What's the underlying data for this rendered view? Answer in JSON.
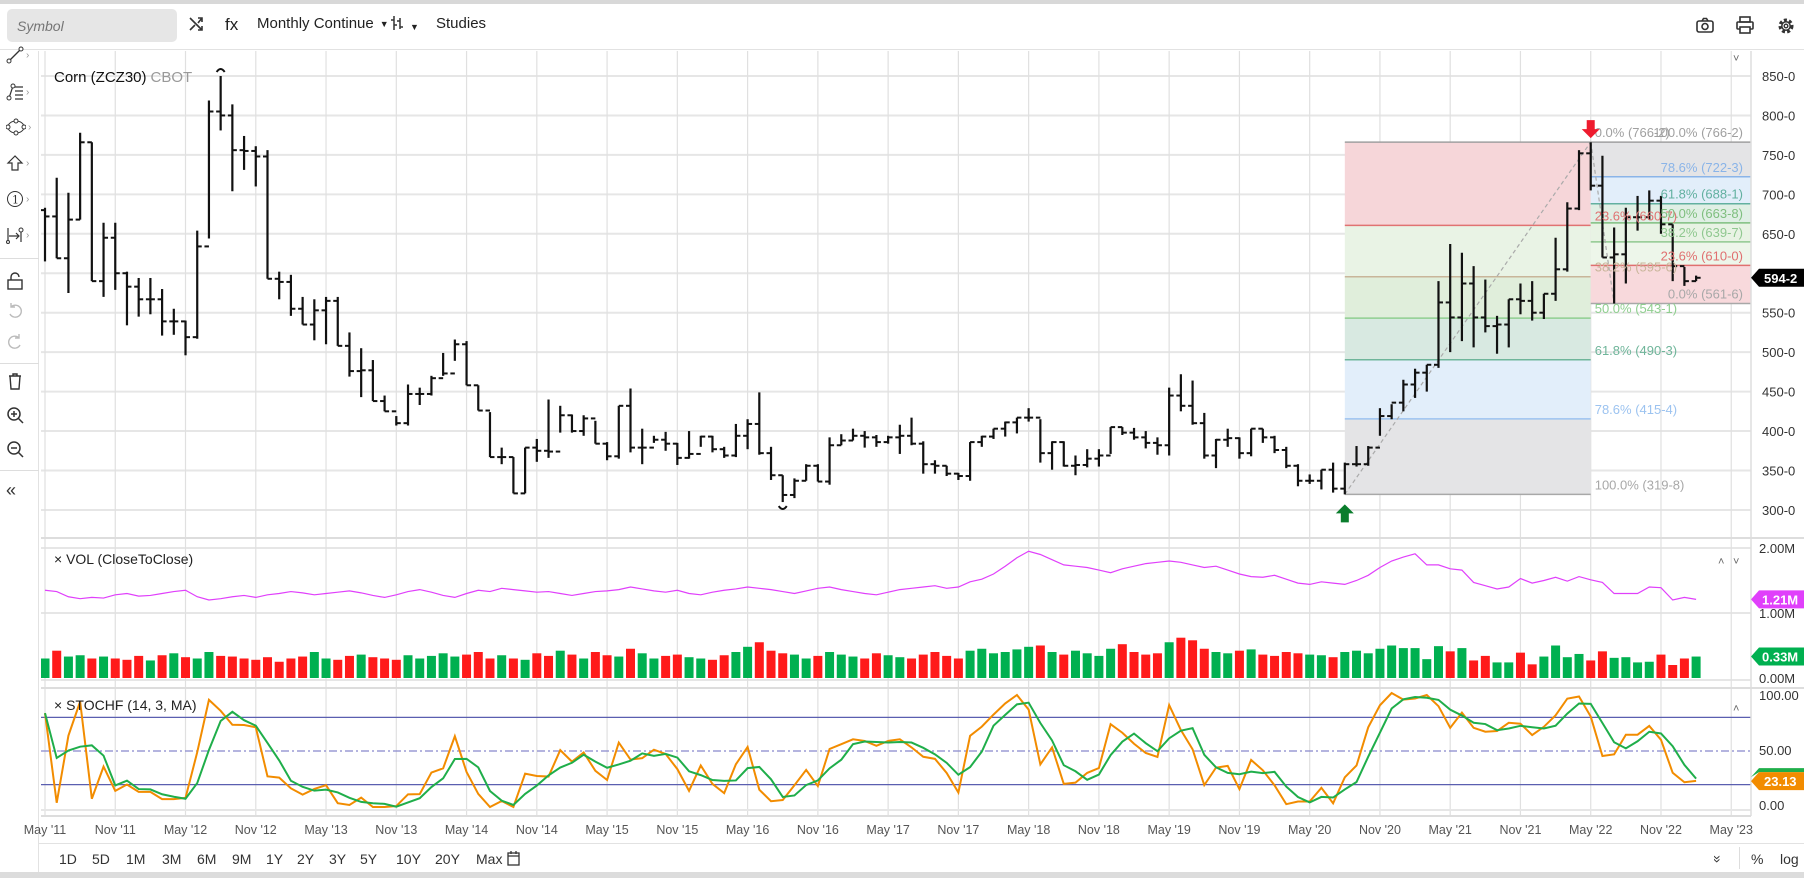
{
  "toolbar": {
    "symbol_placeholder": "Symbol",
    "fx_label": "fx",
    "interval": "Monthly Continue",
    "studies": "Studies"
  },
  "chart": {
    "title": "Corn (ZCZ30)",
    "exchange": "CBOT",
    "last_price": "594-2",
    "last_price_value": 594.25
  },
  "price_axis": [
    "850-0",
    "800-0",
    "750-0",
    "700-0",
    "650-0",
    "600-0",
    "550-0",
    "500-0",
    "450-0",
    "400-0",
    "350-0",
    "300-0"
  ],
  "date_labels": [
    "May '11",
    "Nov '11",
    "May '12",
    "Nov '12",
    "May '13",
    "Nov '13",
    "May '14",
    "Nov '14",
    "May '15",
    "Nov '15",
    "May '16",
    "Nov '16",
    "May '17",
    "Nov '17",
    "May '18",
    "Nov '18",
    "May '19",
    "Nov '19",
    "May '20",
    "Nov '20",
    "May '21",
    "Nov '21",
    "May '22",
    "Nov '22",
    "May '23"
  ],
  "vol_study": {
    "label": "× VOL (CloseToClose)",
    "axis": [
      "2.00M",
      "1.00M",
      "0.00M"
    ],
    "line_last": "1.21M",
    "volume_last": "0.33M",
    "line_color": "#e040fb",
    "up_color": "#00b050",
    "down_color": "#ff1a1a"
  },
  "stoch_study": {
    "label": "× STOCHF (14, 3, MA)",
    "axis": [
      "100.00",
      "50.00",
      "0.00"
    ],
    "last": "23.13",
    "k_color": "#f28c00",
    "d_color": "#1fae4a",
    "upper_band": 80,
    "lower_band": 20
  },
  "fib_left": [
    {
      "label": "0.0% (766-2)",
      "price": 766.25,
      "color": "#a0a0a0"
    },
    {
      "label": "23.6% (660-7)",
      "price": 660.7,
      "color": "#e07272"
    },
    {
      "label": "38.2% (595-6)",
      "price": 595.6,
      "color": "#c9b59a"
    },
    {
      "label": "50.0% (543-1)",
      "price": 543.1,
      "color": "#8fcf8f"
    },
    {
      "label": "61.8% (490-3)",
      "price": 490.3,
      "color": "#6fb59a"
    },
    {
      "label": "78.6% (415-4)",
      "price": 415.4,
      "color": "#9cc3f0"
    },
    {
      "label": "100.0% (319-8)",
      "price": 319.8,
      "color": "#a8a8a8"
    }
  ],
  "fib_right": [
    {
      "label": "100.0% (766-2)",
      "price": 766.25,
      "color": "#a0a0a0"
    },
    {
      "label": "78.6% (722-3)",
      "price": 722.3,
      "color": "#8ab4e8"
    },
    {
      "label": "61.8% (688-1)",
      "price": 688.1,
      "color": "#62b0a0"
    },
    {
      "label": "50.0% (663-8)",
      "price": 663.8,
      "color": "#7fbf7f"
    },
    {
      "label": "38.2% (639-7)",
      "price": 639.7,
      "color": "#90c890"
    },
    {
      "label": "23.6% (610-0)",
      "price": 610.0,
      "color": "#e07070"
    },
    {
      "label": "0.0% (561-6)",
      "price": 561.6,
      "color": "#a8a8a8"
    }
  ],
  "ranges": [
    "1D",
    "5D",
    "1M",
    "3M",
    "6M",
    "9M",
    "1Y",
    "2Y",
    "3Y",
    "5Y",
    "10Y",
    "20Y",
    "Max"
  ],
  "bottom_right": {
    "percent": "%",
    "log": "log"
  },
  "icons": {
    "left_tools": [
      "line-tool-icon",
      "fib-tool-icon",
      "shapes-tool-icon",
      "arrow-tool-icon",
      "annotation-tool-icon",
      "measure-tool-icon",
      "lock-icon",
      "undo-icon",
      "redo-icon",
      "trash-icon",
      "zoom-in-icon",
      "zoom-out-icon",
      "collapse-icon"
    ],
    "top_right": [
      "camera-icon",
      "print-icon",
      "gear-icon"
    ]
  },
  "chart_data": {
    "type": "ohlc",
    "title": "Corn (ZCZ30) CBOT",
    "interval": "monthly",
    "start": "May 2011",
    "end": "Feb 2023",
    "ylim": [
      275,
      875
    ],
    "close": [
      672,
      619,
      668,
      766,
      590,
      645,
      600,
      583,
      567,
      567,
      539,
      539,
      519,
      634,
      805,
      800,
      756,
      755,
      748,
      593,
      589,
      555,
      535,
      553,
      565,
      508,
      476,
      477,
      438,
      425,
      410,
      447,
      447,
      467,
      473,
      510,
      458,
      426,
      367,
      367,
      321,
      379,
      375,
      374,
      420,
      400,
      416,
      384,
      368,
      432,
      379,
      379,
      389,
      384,
      366,
      371,
      393,
      377,
      369,
      394,
      409,
      372,
      344,
      319,
      337,
      356,
      336,
      382,
      388,
      394,
      392,
      386,
      392,
      394,
      384,
      358,
      356,
      346,
      343,
      386,
      393,
      403,
      411,
      417,
      417,
      372,
      386,
      356,
      357,
      365,
      369,
      405,
      398,
      392,
      385,
      382,
      445,
      432,
      410,
      369,
      389,
      391,
      372,
      403,
      392,
      376,
      356,
      337,
      337,
      351,
      327,
      358,
      358,
      379,
      419,
      436,
      459,
      474,
      484,
      563,
      544,
      587,
      544,
      533,
      535,
      567,
      565,
      550,
      574,
      605,
      682,
      752,
      711,
      620,
      624,
      671,
      671,
      692,
      662,
      609,
      590,
      594.25
    ],
    "high": [
      683,
      721,
      702,
      778,
      766,
      664,
      664,
      602,
      594,
      594,
      580,
      555,
      540,
      654,
      819,
      850,
      814,
      774,
      761,
      756,
      602,
      598,
      570,
      567,
      570,
      570,
      525,
      505,
      490,
      445,
      419,
      459,
      455,
      470,
      499,
      516,
      514,
      458,
      424,
      379,
      367,
      379,
      390,
      440,
      432,
      421,
      420,
      413,
      386,
      432,
      454,
      403,
      394,
      399,
      385,
      400,
      394,
      394,
      380,
      409,
      415,
      449,
      380,
      344,
      340,
      358,
      358,
      392,
      396,
      403,
      400,
      395,
      394,
      408,
      417,
      387,
      363,
      356,
      347,
      386,
      394,
      403,
      412,
      417,
      429,
      415,
      387,
      387,
      369,
      377,
      377,
      405,
      405,
      404,
      400,
      392,
      455,
      472,
      464,
      423,
      390,
      403,
      392,
      403,
      403,
      394,
      380,
      358,
      345,
      351,
      360,
      360,
      381,
      381,
      429,
      434,
      465,
      479,
      484,
      590,
      637,
      626,
      609,
      592,
      546,
      567,
      587,
      590,
      574,
      645,
      690,
      756,
      766,
      749,
      658,
      683,
      698,
      705,
      698,
      662,
      608,
      597
    ],
    "low": [
      615,
      619,
      575,
      668,
      590,
      570,
      579,
      534,
      545,
      548,
      521,
      522,
      496,
      517,
      644,
      781,
      704,
      731,
      710,
      593,
      567,
      546,
      535,
      515,
      510,
      508,
      469,
      443,
      438,
      425,
      407,
      407,
      433,
      445,
      470,
      489,
      458,
      426,
      367,
      358,
      321,
      321,
      361,
      366,
      398,
      398,
      394,
      384,
      363,
      365,
      373,
      358,
      385,
      375,
      357,
      365,
      380,
      373,
      366,
      367,
      377,
      370,
      338,
      310,
      315,
      337,
      336,
      332,
      382,
      388,
      379,
      380,
      384,
      371,
      382,
      346,
      346,
      343,
      338,
      337,
      380,
      390,
      393,
      397,
      412,
      360,
      351,
      355,
      344,
      354,
      355,
      371,
      395,
      389,
      378,
      370,
      369,
      425,
      408,
      365,
      353,
      380,
      365,
      368,
      385,
      372,
      353,
      330,
      333,
      326,
      322,
      319.75,
      355,
      356,
      394,
      415,
      425,
      442,
      450,
      480,
      500,
      514,
      506,
      525,
      498,
      506,
      548,
      540,
      542,
      565,
      602,
      680,
      705,
      620,
      561.6,
      587,
      654,
      668,
      650,
      590,
      584,
      590
    ],
    "volume_millions": [
      0.3,
      0.42,
      0.33,
      0.35,
      0.3,
      0.33,
      0.3,
      0.28,
      0.34,
      0.27,
      0.35,
      0.38,
      0.32,
      0.3,
      0.4,
      0.34,
      0.33,
      0.3,
      0.28,
      0.32,
      0.25,
      0.3,
      0.33,
      0.4,
      0.3,
      0.28,
      0.34,
      0.36,
      0.32,
      0.3,
      0.28,
      0.35,
      0.3,
      0.34,
      0.38,
      0.33,
      0.36,
      0.4,
      0.3,
      0.35,
      0.3,
      0.28,
      0.38,
      0.34,
      0.42,
      0.36,
      0.3,
      0.4,
      0.35,
      0.33,
      0.45,
      0.38,
      0.3,
      0.34,
      0.36,
      0.32,
      0.3,
      0.28,
      0.35,
      0.4,
      0.48,
      0.55,
      0.42,
      0.38,
      0.36,
      0.3,
      0.34,
      0.4,
      0.36,
      0.33,
      0.3,
      0.38,
      0.35,
      0.32,
      0.3,
      0.36,
      0.4,
      0.34,
      0.3,
      0.42,
      0.45,
      0.38,
      0.4,
      0.44,
      0.48,
      0.5,
      0.4,
      0.36,
      0.42,
      0.38,
      0.34,
      0.45,
      0.52,
      0.4,
      0.36,
      0.38,
      0.55,
      0.62,
      0.58,
      0.45,
      0.4,
      0.38,
      0.42,
      0.44,
      0.36,
      0.34,
      0.4,
      0.38,
      0.36,
      0.35,
      0.32,
      0.4,
      0.42,
      0.38,
      0.45,
      0.5,
      0.46,
      0.46,
      0.29,
      0.49,
      0.41,
      0.46,
      0.27,
      0.34,
      0.24,
      0.24,
      0.39,
      0.21,
      0.33,
      0.5,
      0.32,
      0.37,
      0.27,
      0.41,
      0.31,
      0.32,
      0.24,
      0.25,
      0.36,
      0.2,
      0.3,
      0.33
    ],
    "volatility_millions": [
      1.35,
      1.33,
      1.25,
      1.22,
      1.24,
      1.23,
      1.28,
      1.3,
      1.26,
      1.27,
      1.3,
      1.33,
      1.35,
      1.25,
      1.2,
      1.22,
      1.25,
      1.27,
      1.24,
      1.28,
      1.3,
      1.33,
      1.31,
      1.28,
      1.3,
      1.32,
      1.34,
      1.31,
      1.27,
      1.24,
      1.28,
      1.33,
      1.36,
      1.32,
      1.27,
      1.24,
      1.3,
      1.35,
      1.33,
      1.38,
      1.36,
      1.34,
      1.32,
      1.33,
      1.3,
      1.27,
      1.3,
      1.33,
      1.34,
      1.36,
      1.4,
      1.37,
      1.34,
      1.32,
      1.35,
      1.3,
      1.28,
      1.32,
      1.35,
      1.37,
      1.4,
      1.38,
      1.36,
      1.33,
      1.3,
      1.34,
      1.38,
      1.4,
      1.36,
      1.33,
      1.3,
      1.28,
      1.32,
      1.36,
      1.38,
      1.4,
      1.42,
      1.38,
      1.4,
      1.48,
      1.52,
      1.6,
      1.72,
      1.85,
      1.95,
      1.9,
      1.82,
      1.74,
      1.72,
      1.7,
      1.66,
      1.62,
      1.68,
      1.72,
      1.76,
      1.78,
      1.8,
      1.78,
      1.74,
      1.7,
      1.72,
      1.66,
      1.6,
      1.56,
      1.55,
      1.58,
      1.52,
      1.46,
      1.44,
      1.48,
      1.46,
      1.44,
      1.5,
      1.58,
      1.7,
      1.8,
      1.86,
      1.91,
      1.74,
      1.74,
      1.68,
      1.66,
      1.47,
      1.42,
      1.37,
      1.4,
      1.53,
      1.46,
      1.5,
      1.55,
      1.49,
      1.56,
      1.51,
      1.47,
      1.3,
      1.3,
      1.3,
      1.4,
      1.39,
      1.2,
      1.24,
      1.21
    ],
    "stoch_params": {
      "k_period": 14,
      "d_period": 3
    },
    "markers": {
      "high_bar_index": 15,
      "low_bar_index": 63,
      "fib_swing_low_index": 111,
      "fib_swing_high_index": 132,
      "fib_swing_low2_index": 134
    }
  }
}
